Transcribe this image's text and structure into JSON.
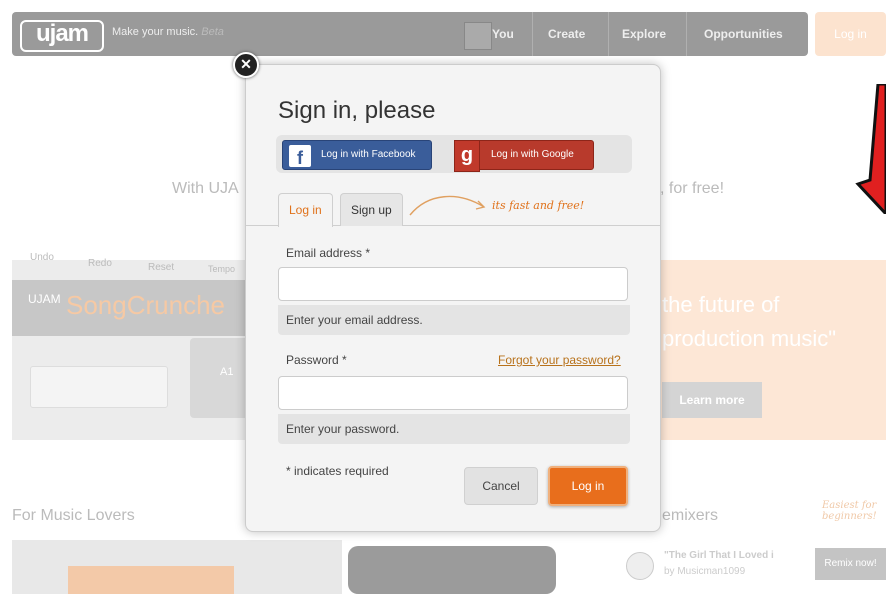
{
  "site": {
    "logo": "ujam",
    "tagline": "Make your music.",
    "beta": "Beta",
    "nav": [
      "You",
      "Create",
      "Explore",
      "Opportunities"
    ],
    "login_top": "Log in",
    "bg_headline_left": "With UJA",
    "bg_headline_right": ", for free!",
    "song_tabs": [
      "Undo",
      "Redo",
      "Reset",
      "Tempo"
    ],
    "product_prefix": "UJAM",
    "product_name": "SongCrunche",
    "pad_label": "A1",
    "promo_line1": "the future of",
    "promo_line2": "production music\"",
    "learn_more": "Learn more",
    "section_left": "For Music Lovers",
    "section_right": "emixers",
    "easiest_note": "Easiest for beginners!",
    "track_title": "\"The Girl That I Loved i",
    "track_artist": "by Musicman1099",
    "remix_now": "Remix now!"
  },
  "dialog": {
    "close_symbol": "✕",
    "title": "Sign in, please",
    "facebook_label": "Log in with Facebook",
    "google_label": "Log in with Google",
    "tab_login": "Log in",
    "tab_signup": "Sign up",
    "hand_note": "its fast and free!",
    "email_label": "Email address *",
    "email_value": "",
    "email_hint": "Enter your email address.",
    "password_label": "Password *",
    "password_value": "",
    "forgot_link": "Forgot your password?",
    "password_hint": "Enter your password.",
    "required_note": "* indicates required",
    "cancel_label": "Cancel",
    "login_label": "Log in"
  },
  "colors": {
    "accent": "#e86e1c",
    "facebook": "#3a5d9a",
    "google": "#b83a2c"
  }
}
